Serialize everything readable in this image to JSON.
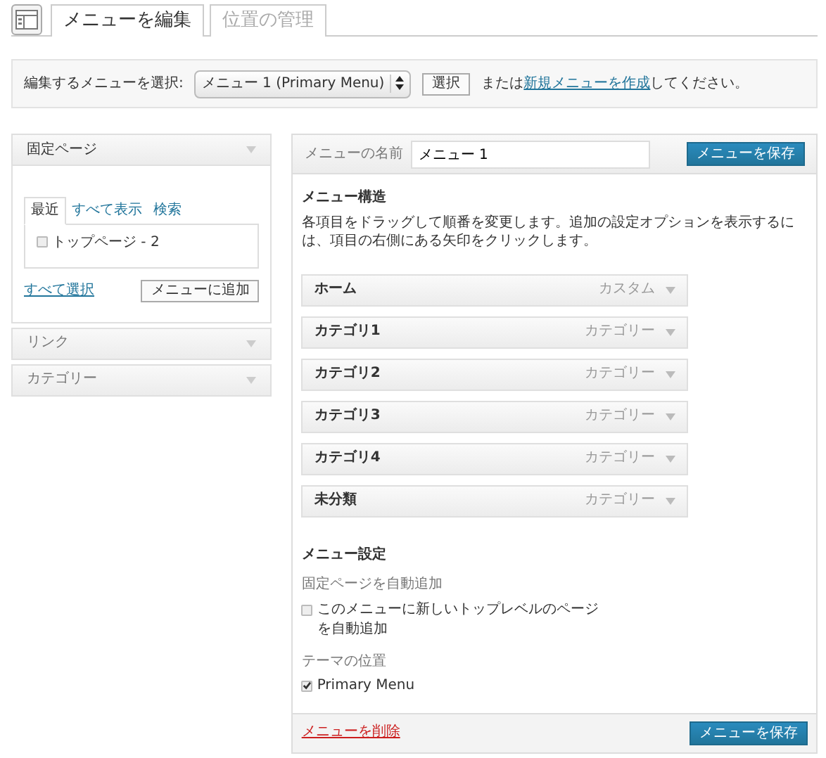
{
  "tabs": [
    {
      "label": "メニューを編集",
      "selected": true
    },
    {
      "label": "位置の管理",
      "selected": false
    }
  ],
  "menu_select": {
    "label": "編集するメニューを選択:",
    "value": "メニュー 1 (Primary Menu)",
    "button": "選択",
    "text_before_link": "または",
    "link": "新規メニューを作成",
    "text_after_link": "してください。"
  },
  "side_panels": [
    {
      "title": "固定ページ",
      "expanded": true,
      "tabs": [
        {
          "label": "最近",
          "selected": true
        },
        {
          "label": "すべて表示",
          "selected": false
        },
        {
          "label": "検索",
          "selected": false
        }
      ],
      "items": [
        {
          "label": "トップページ - 2",
          "checked": false
        }
      ],
      "select_all": "すべて選択",
      "add_button": "メニューに追加"
    },
    {
      "title": "リンク",
      "expanded": false
    },
    {
      "title": "カテゴリー",
      "expanded": false
    }
  ],
  "editor": {
    "name_label": "メニューの名前",
    "name_value": "メニュー 1",
    "save_button": "メニューを保存",
    "structure_heading": "メニュー構造",
    "structure_help": "各項目をドラッグして順番を変更します。追加の設定オプションを表示するには、項目の右側にある矢印をクリックします。",
    "items": [
      {
        "title": "ホーム",
        "type": "カスタム"
      },
      {
        "title": "カテゴリ1",
        "type": "カテゴリー"
      },
      {
        "title": "カテゴリ2",
        "type": "カテゴリー"
      },
      {
        "title": "カテゴリ3",
        "type": "カテゴリー"
      },
      {
        "title": "カテゴリ4",
        "type": "カテゴリー"
      },
      {
        "title": "未分類",
        "type": "カテゴリー"
      }
    ],
    "settings_heading": "メニュー設定",
    "auto_add_label": "固定ページを自動追加",
    "auto_add_option": {
      "label": "このメニューに新しいトップレベルのページを自動追加",
      "checked": false
    },
    "location_label": "テーマの位置",
    "locations": [
      {
        "label": "Primary Menu",
        "checked": true
      }
    ],
    "delete_link": "メニューを削除",
    "save_button_bottom": "メニューを保存"
  }
}
